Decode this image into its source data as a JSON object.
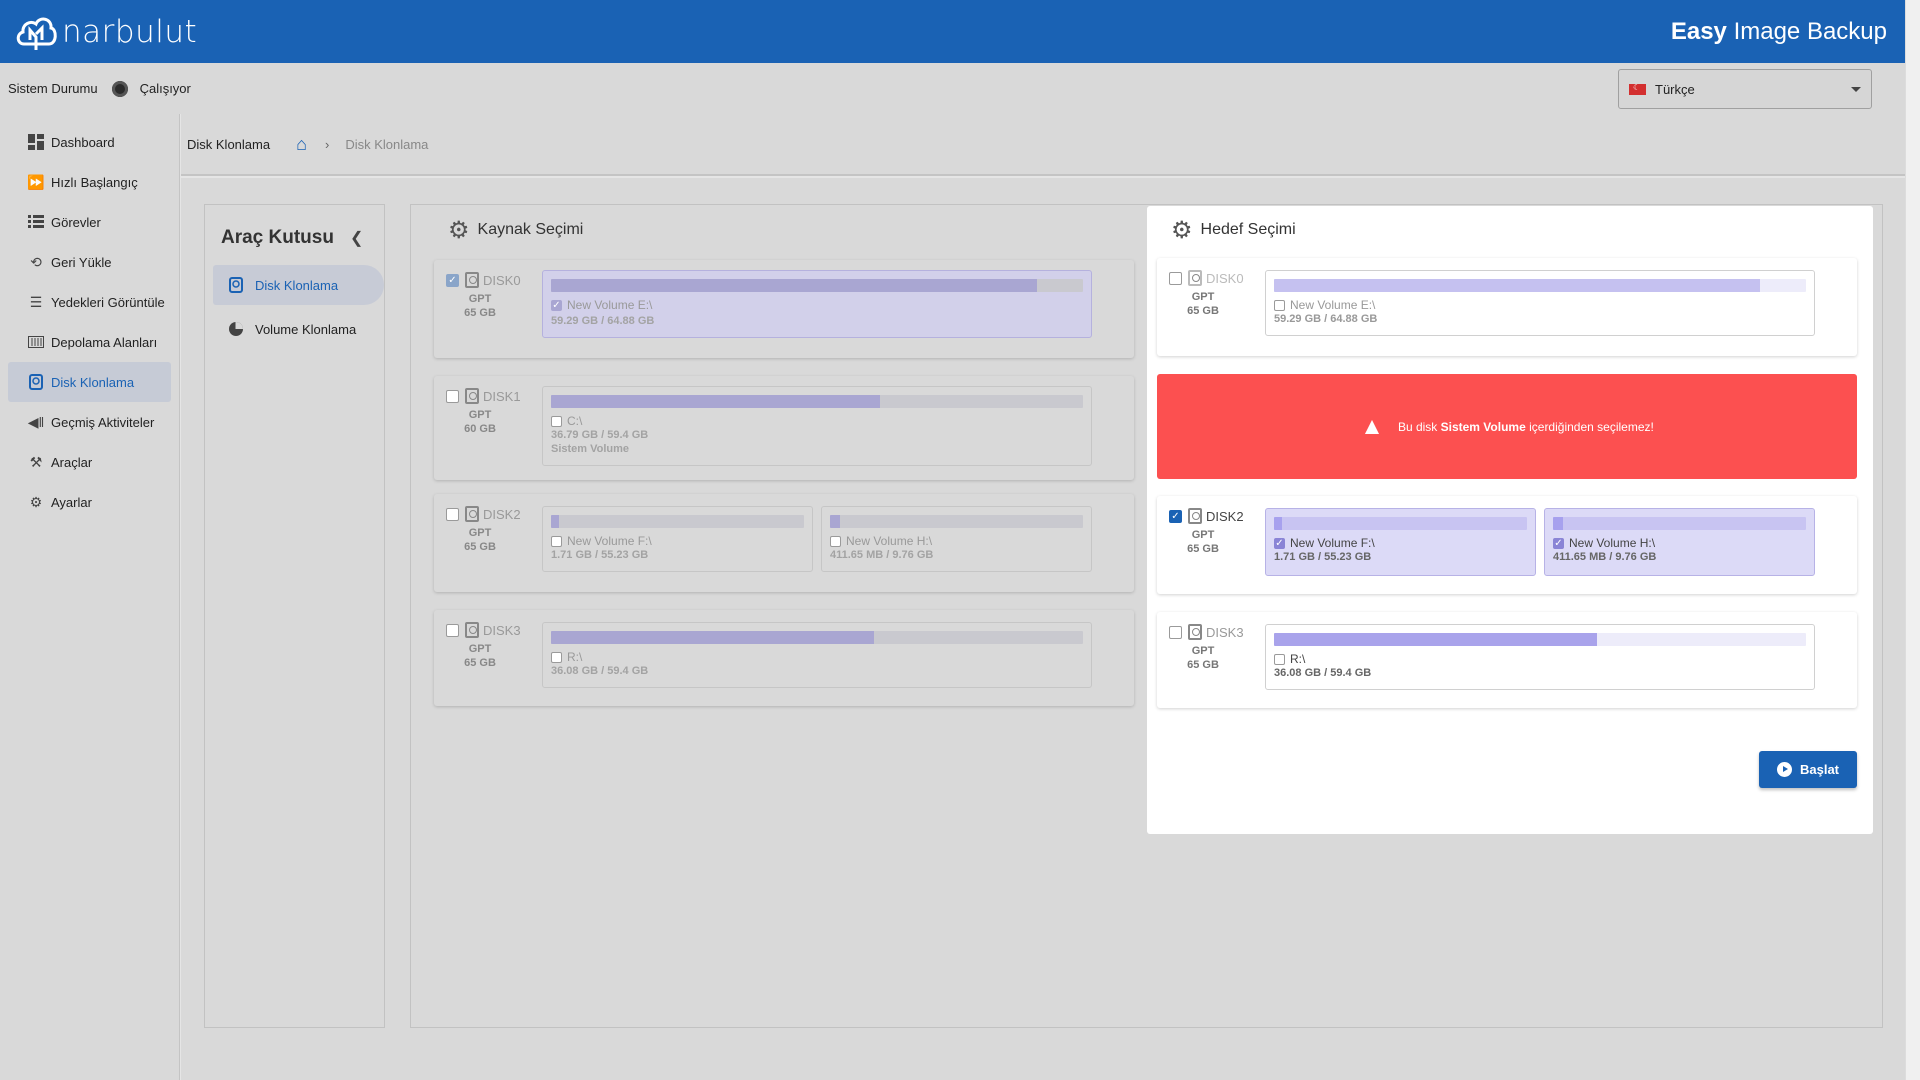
{
  "header": {
    "logo_text": "narbulut",
    "app_title_bold": "Easy",
    "app_title_rest": " Image Backup"
  },
  "status": {
    "label": "Sistem Durumu",
    "value": "Çalışıyor",
    "language": "Türkçe"
  },
  "sidebar": {
    "items": [
      {
        "label": "Dashboard",
        "icon": "dashboard-icon"
      },
      {
        "label": "Hızlı Başlangıç",
        "icon": "fast-forward-icon"
      },
      {
        "label": "Görevler",
        "icon": "list-icon"
      },
      {
        "label": "Geri Yükle",
        "icon": "restore-icon"
      },
      {
        "label": "Yedekleri Görüntüle",
        "icon": "view-list-icon"
      },
      {
        "label": "Depolama Alanları",
        "icon": "storage-icon"
      },
      {
        "label": "Disk Klonlama",
        "icon": "disk-icon",
        "active": true
      },
      {
        "label": "Geçmiş Aktiviteler",
        "icon": "history-icon"
      },
      {
        "label": "Araçlar",
        "icon": "tools-icon"
      },
      {
        "label": "Ayarlar",
        "icon": "gear-icon"
      }
    ]
  },
  "breadcrumb": {
    "title": "Disk Klonlama",
    "current": "Disk Klonlama"
  },
  "toolbox": {
    "title": "Araç Kutusu",
    "items": [
      {
        "label": "Disk Klonlama",
        "active": true
      },
      {
        "label": "Volume Klonlama"
      }
    ]
  },
  "source": {
    "title": "Kaynak Seçimi",
    "disks": [
      {
        "name": "DISK0",
        "type": "GPT",
        "size": "65 GB",
        "checked": true,
        "volumes": [
          {
            "name": "New Volume E:\\",
            "usage": "59.29 GB / 64.88 GB",
            "fill": 0.914,
            "checked": true
          }
        ]
      },
      {
        "name": "DISK1",
        "type": "GPT",
        "size": "60 GB",
        "checked": false,
        "volumes": [
          {
            "name": "C:\\",
            "usage": "36.79 GB / 59.4 GB",
            "fill": 0.619,
            "extra": "Sistem Volume"
          }
        ]
      },
      {
        "name": "DISK2",
        "type": "GPT",
        "size": "65 GB",
        "checked": false,
        "volumes": [
          {
            "name": "New Volume F:\\",
            "usage": "1.71 GB / 55.23 GB",
            "fill": 0.031
          },
          {
            "name": "New Volume H:\\",
            "usage": "411.65 MB / 9.76 GB",
            "fill": 0.041
          }
        ]
      },
      {
        "name": "DISK3",
        "type": "GPT",
        "size": "65 GB",
        "checked": false,
        "volumes": [
          {
            "name": "R:\\",
            "usage": "36.08 GB / 59.4 GB",
            "fill": 0.607
          }
        ]
      }
    ]
  },
  "target": {
    "title": "Hedef Seçimi",
    "disks": [
      {
        "name": "DISK0",
        "type": "GPT",
        "size": "65 GB",
        "checked": false,
        "volumes": [
          {
            "name": "New Volume E:\\",
            "usage": "59.29 GB / 64.88 GB",
            "fill": 0.914
          }
        ]
      },
      {
        "name": "DISK2",
        "type": "GPT",
        "size": "65 GB",
        "checked": true,
        "volumes": [
          {
            "name": "New Volume F:\\",
            "usage": "1.71 GB / 55.23 GB",
            "fill": 0.031,
            "checked": true
          },
          {
            "name": "New Volume H:\\",
            "usage": "411.65 MB / 9.76 GB",
            "fill": 0.041,
            "checked": true
          }
        ]
      },
      {
        "name": "DISK3",
        "type": "GPT",
        "size": "65 GB",
        "checked": false,
        "volumes": [
          {
            "name": "R:\\",
            "usage": "36.08 GB / 59.4 GB",
            "fill": 0.607
          }
        ]
      }
    ],
    "alert": {
      "prefix": "Bu disk ",
      "bold": "Sistem Volume",
      "suffix": " içerdiğinden seçilemez!"
    },
    "start_label": "Başlat"
  },
  "colors": {
    "brand": "#1a62b4",
    "alert": "#fc5050",
    "volume_fill": "#a9a3eb"
  }
}
